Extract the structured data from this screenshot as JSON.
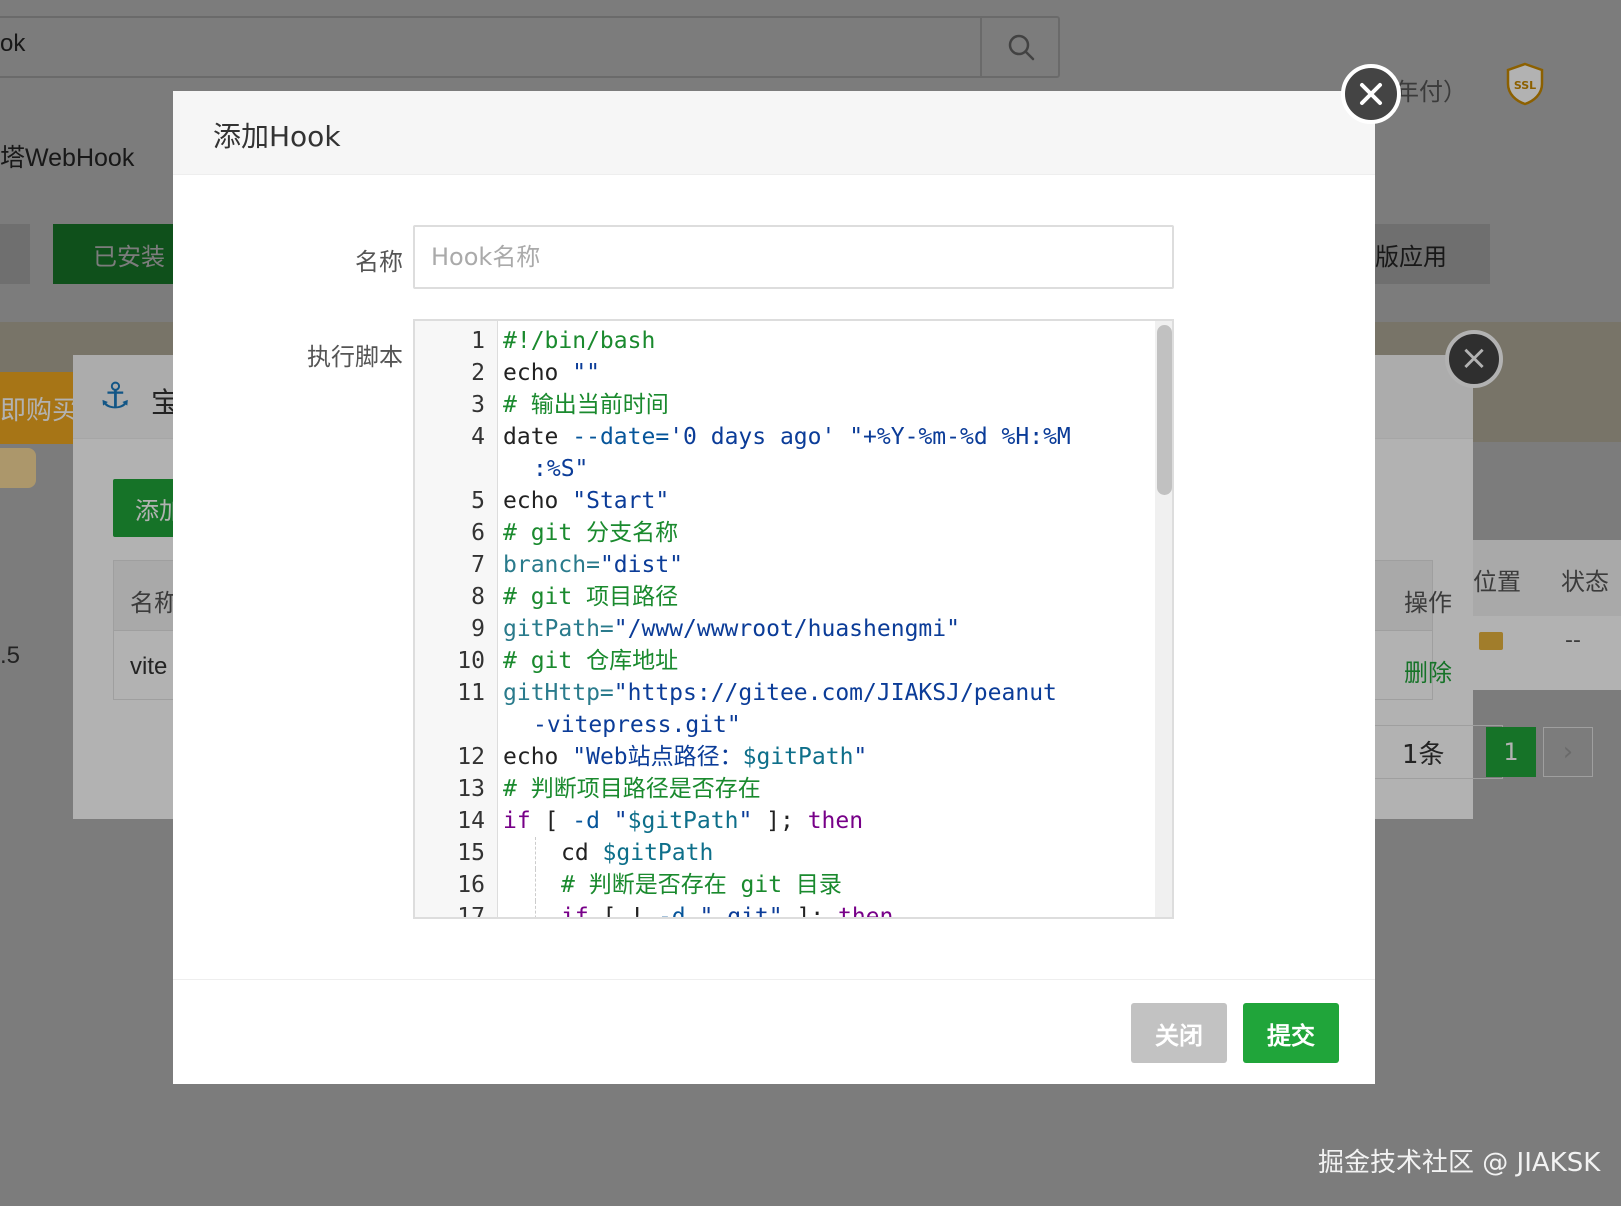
{
  "background": {
    "search_text": "ok",
    "webhook_label": "塔WebHook",
    "installed_tab": "已安装",
    "right_tab": "版应用",
    "buy_label": "即购买",
    "version": ".5",
    "position_header": "位置",
    "status_header": "状态",
    "status_value": "--"
  },
  "middle_dialog": {
    "title": "宝",
    "pay_text": "年付）",
    "ssl_badge": "SSL",
    "add_button": "添加",
    "table_header_name": "名称",
    "table_header_ops": "操作",
    "row_name": "vite",
    "delete_link": "删除",
    "count_text": "1条",
    "page_current": "1",
    "page_next": "›"
  },
  "dialog": {
    "title": "添加Hook",
    "name_label": "名称",
    "name_placeholder": "Hook名称",
    "script_label": "执行脚本",
    "close_button": "关闭",
    "submit_button": "提交"
  },
  "watermark": "掘金技术社区 @ JIAKSK",
  "code_lines": [
    {
      "n": "1",
      "indent": 0,
      "tokens": [
        {
          "t": "#!/bin/bash",
          "c": "c"
        }
      ]
    },
    {
      "n": "2",
      "indent": 0,
      "tokens": [
        {
          "t": "echo ",
          "c": "n"
        },
        {
          "t": "\"\"",
          "c": "s"
        }
      ]
    },
    {
      "n": "3",
      "indent": 0,
      "tokens": [
        {
          "t": "# 输出当前时间",
          "c": "c"
        }
      ]
    },
    {
      "n": "4",
      "indent": 0,
      "tokens": [
        {
          "t": "date ",
          "c": "n"
        },
        {
          "t": "--date=",
          "c": "d"
        },
        {
          "t": "'0 days ago'",
          "c": "s"
        },
        {
          "t": " \"+%Y-%m-%d %H:%M",
          "c": "s"
        }
      ]
    },
    {
      "n": "",
      "indent": 0,
      "wrap": true,
      "tokens": [
        {
          "t": ":%S\"",
          "c": "s"
        }
      ]
    },
    {
      "n": "5",
      "indent": 0,
      "tokens": [
        {
          "t": "echo ",
          "c": "n"
        },
        {
          "t": "\"Start\"",
          "c": "s"
        }
      ]
    },
    {
      "n": "6",
      "indent": 0,
      "tokens": [
        {
          "t": "# git 分支名称",
          "c": "c"
        }
      ]
    },
    {
      "n": "7",
      "indent": 0,
      "tokens": [
        {
          "t": "branch=",
          "c": "p"
        },
        {
          "t": "\"dist\"",
          "c": "s"
        }
      ]
    },
    {
      "n": "8",
      "indent": 0,
      "tokens": [
        {
          "t": "# git 项目路径",
          "c": "c"
        }
      ]
    },
    {
      "n": "9",
      "indent": 0,
      "tokens": [
        {
          "t": "gitPath=",
          "c": "p"
        },
        {
          "t": "\"/www/wwwroot/huashengmi\"",
          "c": "s"
        }
      ]
    },
    {
      "n": "10",
      "indent": 0,
      "tokens": [
        {
          "t": "# git 仓库地址",
          "c": "c"
        }
      ]
    },
    {
      "n": "11",
      "indent": 0,
      "tokens": [
        {
          "t": "gitHttp=",
          "c": "p"
        },
        {
          "t": "\"https://gitee.com/JIAKSJ/peanut",
          "c": "s"
        }
      ]
    },
    {
      "n": "",
      "indent": 0,
      "wrap": true,
      "tokens": [
        {
          "t": "-vitepress.git\"",
          "c": "s"
        }
      ]
    },
    {
      "n": "12",
      "indent": 0,
      "tokens": [
        {
          "t": "echo ",
          "c": "n"
        },
        {
          "t": "\"Web站点路径：",
          "c": "s"
        },
        {
          "t": "$gitPath",
          "c": "v"
        },
        {
          "t": "\"",
          "c": "s"
        }
      ]
    },
    {
      "n": "13",
      "indent": 0,
      "tokens": [
        {
          "t": "# 判断项目路径是否存在",
          "c": "c"
        }
      ]
    },
    {
      "n": "14",
      "indent": 0,
      "tokens": [
        {
          "t": "if",
          "c": "k"
        },
        {
          "t": " [ ",
          "c": "n"
        },
        {
          "t": "-d",
          "c": "d"
        },
        {
          "t": " \"",
          "c": "s"
        },
        {
          "t": "$gitPath",
          "c": "v"
        },
        {
          "t": "\"",
          "c": "s"
        },
        {
          "t": " ]; ",
          "c": "n"
        },
        {
          "t": "then",
          "c": "k"
        }
      ]
    },
    {
      "n": "15",
      "indent": 1,
      "tokens": [
        {
          "t": "cd ",
          "c": "n"
        },
        {
          "t": "$gitPath",
          "c": "v"
        }
      ]
    },
    {
      "n": "16",
      "indent": 1,
      "tokens": [
        {
          "t": "# 判断是否存在 git 目录",
          "c": "c"
        }
      ]
    },
    {
      "n": "17",
      "indent": 1,
      "tokens": [
        {
          "t": "if",
          "c": "k"
        },
        {
          "t": " [ ! ",
          "c": "n"
        },
        {
          "t": "-d",
          "c": "d"
        },
        {
          "t": " \".git\"",
          "c": "s"
        },
        {
          "t": " ]; ",
          "c": "n"
        },
        {
          "t": "then",
          "c": "k"
        }
      ]
    }
  ]
}
